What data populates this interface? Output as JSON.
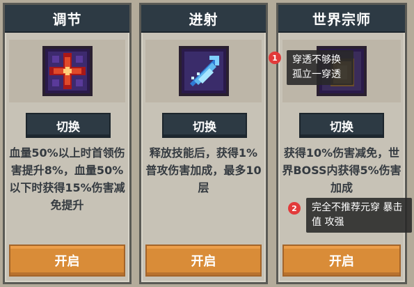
{
  "cards": [
    {
      "title": "调节",
      "icon": "crimson-cross-icon",
      "switch_label": "切换",
      "description": "血量50%以上时首领伤害提升8%，血量50%以下时获得15%伤害减免提升",
      "open_label": "开启"
    },
    {
      "title": "进射",
      "icon": "piercing-shot-icon",
      "switch_label": "切换",
      "description": "释放技能后，获得1%普攻伤害加成，最多10层",
      "open_label": "开启"
    },
    {
      "title": "世界宗师",
      "icon": "world-master-icon",
      "switch_label": "切换",
      "description": "获得10%伤害减免，世界BOSS内获得5%伤害加成",
      "open_label": "开启"
    }
  ],
  "annotations": [
    {
      "number": "1",
      "text": "穿透不够换 孤立一穿透"
    },
    {
      "number": "2",
      "text": "完全不推荐元穿 暴击值 攻强"
    }
  ],
  "colors": {
    "header": "#2d3a44",
    "card_bg": "#c7c2b6",
    "open_button": "#d98c38",
    "badge": "#e23a3a"
  }
}
